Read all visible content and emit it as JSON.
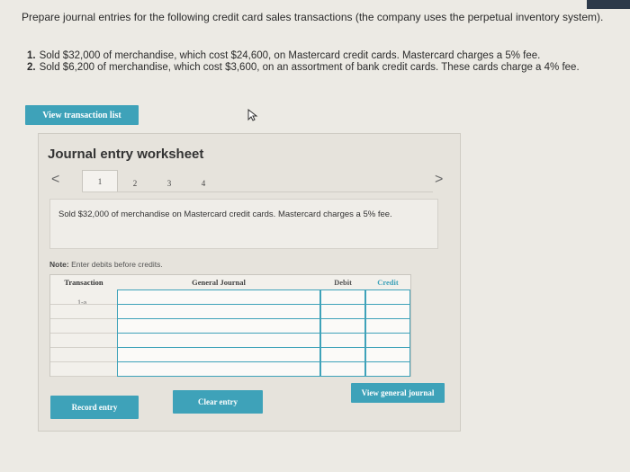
{
  "question": {
    "prompt": "Prepare journal entries for the following credit card sales transactions (the company uses the perpetual inventory system).",
    "transactions": [
      {
        "num": "1.",
        "text": "Sold $32,000 of merchandise, which cost $24,600, on Mastercard credit cards. Mastercard charges a 5% fee."
      },
      {
        "num": "2.",
        "text": "Sold $6,200 of merchandise, which cost $3,600, on an assortment of bank credit cards. These cards charge a 4% fee."
      }
    ]
  },
  "buttons": {
    "view_transaction_list": "View transaction list",
    "record_entry": "Record entry",
    "clear_entry": "Clear entry",
    "view_general_journal": "View general journal"
  },
  "worksheet": {
    "title": "Journal entry worksheet",
    "nav_prev": "<",
    "nav_next": ">",
    "tabs": [
      "1",
      "2",
      "3",
      "4"
    ],
    "active_tab": "1",
    "description": "Sold $32,000 of merchandise on Mastercard credit cards. Mastercard charges a 5% fee.",
    "note_label": "Note:",
    "note_text": "Enter debits before credits.",
    "table": {
      "headers": [
        "Transaction",
        "General Journal",
        "Debit",
        "Credit"
      ],
      "transaction_label": "1-a",
      "rows": 6
    }
  },
  "colors": {
    "accent": "#3ea2b9",
    "background": "#eceae4"
  }
}
